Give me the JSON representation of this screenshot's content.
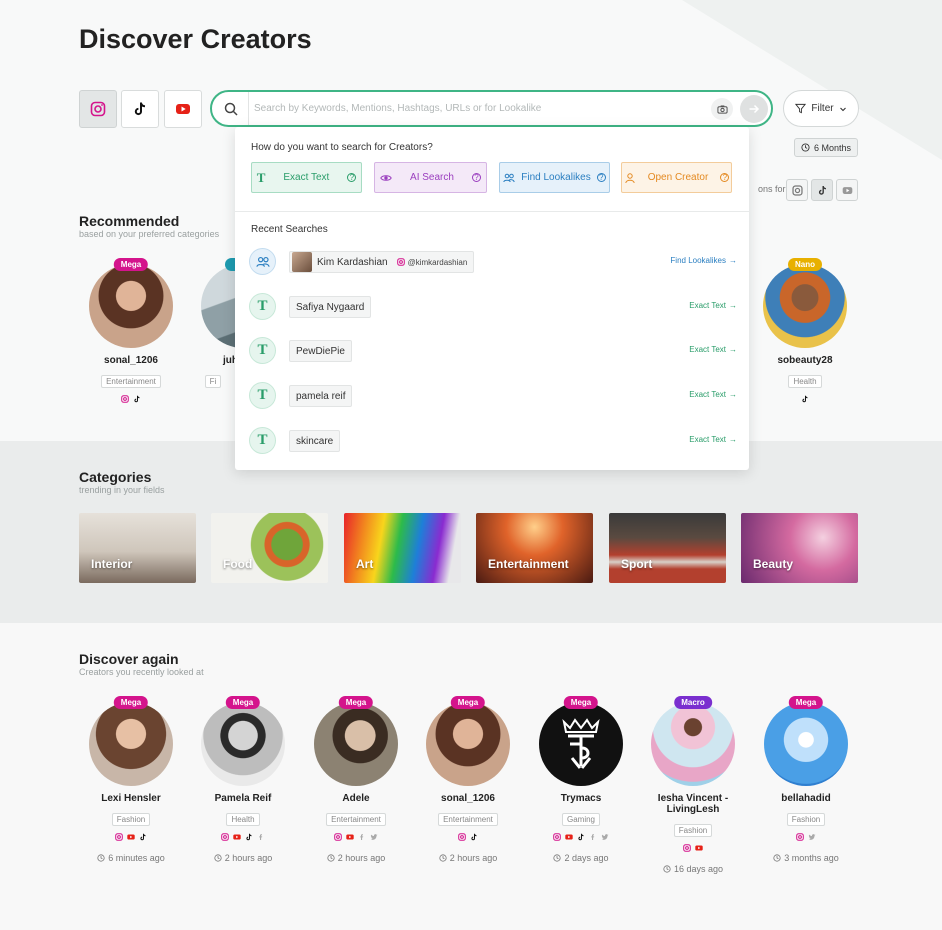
{
  "page": {
    "title": "Discover Creators"
  },
  "platforms": [
    "instagram-icon",
    "tiktok-icon",
    "youtube-icon"
  ],
  "search": {
    "placeholder": "Search by Keywords, Mentions, Hashtags, URLs or for Lookalike"
  },
  "filter": {
    "label": "Filter"
  },
  "period": {
    "label": "6 Months"
  },
  "suggestions_label": "ons for:",
  "dropdown": {
    "question": "How do you want to search for Creators?",
    "modes": {
      "exact": "Exact Text",
      "ai": "AI Search",
      "lookalikes": "Find Lookalikes",
      "open": "Open Creator"
    },
    "recent_title": "Recent Searches",
    "recent": [
      {
        "text": "Kim Kardashian",
        "handle": "@kimkardashian",
        "action": "Find Lookalikes"
      },
      {
        "text": "Safiya Nygaard",
        "action": "Exact Text"
      },
      {
        "text": "PewDiePie",
        "action": "Exact Text"
      },
      {
        "text": "pamela reif",
        "action": "Exact Text"
      },
      {
        "text": "skincare",
        "action": "Exact Text"
      }
    ]
  },
  "recommended": {
    "title": "Recommended",
    "subtitle": "based on your preferred categories",
    "creators": [
      {
        "name": "sonal_1206",
        "badge": "Mega",
        "category": "Entertainment"
      },
      {
        "name": "juh",
        "badge": "",
        "category": "Fi"
      },
      {
        "name": "sobeauty28",
        "badge": "Nano",
        "category": "Health"
      }
    ]
  },
  "categories": {
    "title": "Categories",
    "subtitle": "trending in your fields",
    "items": [
      "Interior",
      "Food",
      "Art",
      "Entertainment",
      "Sport",
      "Beauty"
    ]
  },
  "discover_again": {
    "title": "Discover again",
    "subtitle": "Creators you recently looked at",
    "creators": [
      {
        "name": "Lexi Hensler",
        "badge": "Mega",
        "category": "Fashion",
        "ago": "6 minutes ago"
      },
      {
        "name": "Pamela Reif",
        "badge": "Mega",
        "category": "Health",
        "ago": "2 hours ago"
      },
      {
        "name": "Adele",
        "badge": "Mega",
        "category": "Entertainment",
        "ago": "2 hours ago"
      },
      {
        "name": "sonal_1206",
        "badge": "Mega",
        "category": "Entertainment",
        "ago": "2 hours ago"
      },
      {
        "name": "Trymacs",
        "badge": "Mega",
        "category": "Gaming",
        "ago": "2 days ago"
      },
      {
        "name": "Iesha Vincent - LivingLesh",
        "badge": "Macro",
        "category": "Fashion",
        "ago": "16 days ago"
      },
      {
        "name": "bellahadid",
        "badge": "Mega",
        "category": "Fashion",
        "ago": "3 months ago"
      }
    ]
  },
  "colors": {
    "accent": "#3fb586",
    "mega": "#d4148c",
    "macro": "#7a2fcf",
    "nano": "#e8b000"
  }
}
